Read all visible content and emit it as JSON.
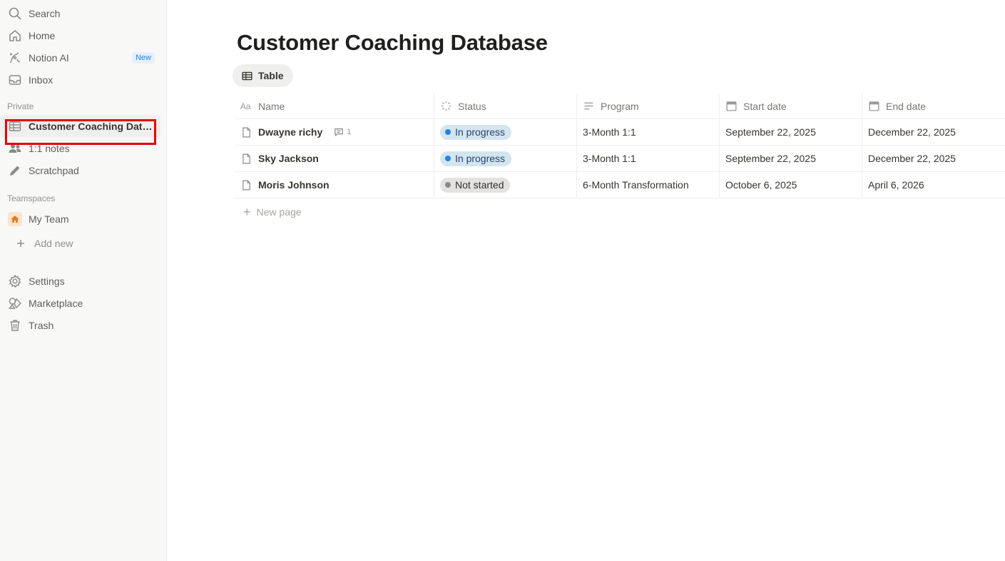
{
  "sidebar": {
    "top_items": [
      {
        "label": "Search",
        "icon": "search-icon"
      },
      {
        "label": "Home",
        "icon": "home-icon"
      },
      {
        "label": "Notion AI",
        "icon": "notion-ai-icon",
        "badge": "New"
      },
      {
        "label": "Inbox",
        "icon": "inbox-icon"
      }
    ],
    "private_label": "Private",
    "private_items": [
      {
        "label": "Customer Coaching Data...",
        "icon": "table-icon"
      },
      {
        "label": "1:1 notes",
        "icon": "people-icon"
      },
      {
        "label": "Scratchpad",
        "icon": "pencil-icon"
      }
    ],
    "teamspaces_label": "Teamspaces",
    "team_item": {
      "label": "My Team",
      "icon": "house-icon"
    },
    "add_new": "Add new",
    "bottom_items": [
      {
        "label": "Settings",
        "icon": "gear-icon"
      },
      {
        "label": "Marketplace",
        "icon": "marketplace-icon"
      },
      {
        "label": "Trash",
        "icon": "trash-icon"
      }
    ]
  },
  "page": {
    "title": "Customer Coaching Database",
    "view_tab": "Table"
  },
  "table": {
    "columns": {
      "name": "Name",
      "status": "Status",
      "program": "Program",
      "start": "Start date",
      "end": "End date"
    },
    "rows": [
      {
        "name": "Dwayne richy",
        "comments": "1",
        "status": "In progress",
        "program": "3-Month 1:1",
        "start": "September 22, 2025",
        "end": "December 22, 2025"
      },
      {
        "name": "Sky Jackson",
        "comments": "",
        "status": "In progress",
        "program": "3-Month 1:1",
        "start": "September 22, 2025",
        "end": "December 22, 2025"
      },
      {
        "name": "Moris Johnson",
        "comments": "",
        "status": "Not started",
        "program": "6-Month Transformation",
        "start": "October 6, 2025",
        "end": "April 6, 2026"
      }
    ],
    "new_page": "New page"
  },
  "colors": {
    "in_progress": "#2383e2",
    "not_started": "#8a8986",
    "highlight": "#e8000b"
  }
}
